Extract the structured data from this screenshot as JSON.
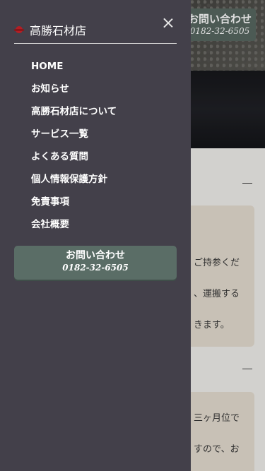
{
  "background": {
    "contact": {
      "label": "お問い合わせ",
      "phone": "0182-32-6505"
    },
    "card1_lines": [
      "ご持参くだ",
      "、運搬する",
      "きます。"
    ],
    "card2_lines": [
      "三ヶ月位で",
      "すので、お"
    ]
  },
  "drawer": {
    "brand_name": "高勝石材店",
    "menu": [
      {
        "label": "HOME"
      },
      {
        "label": "お知らせ"
      },
      {
        "label": "高勝石材店について"
      },
      {
        "label": "サービス一覧"
      },
      {
        "label": "よくある質問"
      },
      {
        "label": "個人情報保護方針"
      },
      {
        "label": "免責事項"
      },
      {
        "label": "会社概要"
      }
    ],
    "contact": {
      "label": "お問い合わせ",
      "phone": "0182-32-6505"
    }
  }
}
